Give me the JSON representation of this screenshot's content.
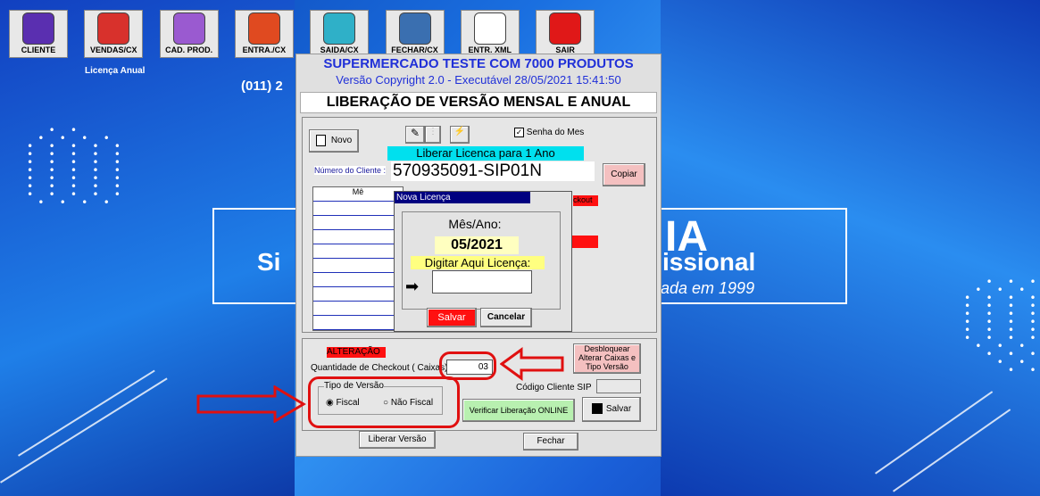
{
  "toolbar": [
    {
      "label": "CLIENTE",
      "color": "#5a2fb0"
    },
    {
      "label": "VENDAS/CX",
      "color": "#d8312c"
    },
    {
      "label": "CAD. PROD.",
      "color": "#9a5ad0"
    },
    {
      "label": "ENTRA./CX",
      "color": "#e04a20"
    },
    {
      "label": "SAIDA/CX",
      "color": "#2fb0c8"
    },
    {
      "label": "FECHAR/CX",
      "color": "#3a6fb0"
    },
    {
      "label": "ENTR. XML",
      "color": "#ffffff"
    },
    {
      "label": "SAIR",
      "color": "#e01818"
    }
  ],
  "licenca_anual": "Licença Anual",
  "phone": "(011) 2",
  "background": {
    "banner_left": "Si",
    "banner_right": "issional",
    "banner_ia": "IA",
    "banner_sub": "ada em 1999"
  },
  "dialog": {
    "title1": "SUPERMERCADO TESTE COM 7000 PRODUTOS",
    "title2": "Versão Copyright 2.0  - Executável 28/05/2021 15:41:50",
    "title3": "LIBERAÇÃO DE VERSÃO MENSAL E ANUAL",
    "novo": "Novo",
    "senha_mes": "Senha do Mes",
    "liberar_ano": "Liberar Licenca para 1 Ano",
    "numero_cliente_label": "Número do Cliente :",
    "numero_cliente": "570935091-SIP01N",
    "copiar": "Copiar",
    "grid_header": "Mê",
    "checkout_clip": "ckout",
    "alteracao": "ALTERAÇÃO",
    "qtd_checkout_label": "Quantidade de Checkout ( Caixas)",
    "qtd_checkout": "03",
    "desbloquear": "Desbloquear Alterar Caixas e Tipo Versão",
    "codigo_cliente": "Código Cliente SIP",
    "tipo_versao": "Tipo de Versão",
    "fiscal": "Fiscal",
    "nao_fiscal": "Não Fiscal",
    "verificar": "Verificar Liberação ONLINE",
    "salvar": "Salvar",
    "liberar_versao": "Liberar Versão",
    "fechar": "Fechar"
  },
  "modal": {
    "title": "Nova Licença",
    "mes_ano_label": "Mês/Ano:",
    "mes_ano": "05/2021",
    "digitar": "Digitar Aqui Licença:",
    "salvar": "Salvar",
    "cancelar": "Cancelar"
  }
}
